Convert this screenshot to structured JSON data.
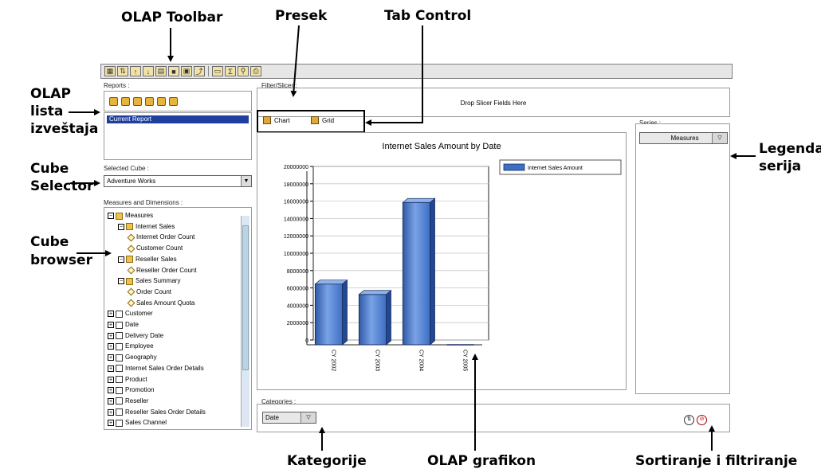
{
  "callouts": {
    "olap_toolbar": "OLAP Toolbar",
    "presek": "Presek",
    "tab_control": "Tab Control",
    "olap_lista_1": "OLAP",
    "olap_lista_2": "lista",
    "olap_lista_3": "izveštaja",
    "cube_selector_1": "Cube",
    "cube_selector_2": "Selector",
    "cube_browser_1": "Cube",
    "cube_browser_2": "browser",
    "legenda_1": "Legenda",
    "legenda_2": "serija",
    "kategorije": "Kategorije",
    "olap_grafikon": "OLAP grafikon",
    "sortiranje": "Sortiranje i filtriranje"
  },
  "reports": {
    "label": "Reports :",
    "items": [
      "Current Report"
    ]
  },
  "cube": {
    "label": "Selected Cube :",
    "value": "Adventure Works"
  },
  "tree": {
    "label": "Measures and Dimensions :",
    "rows": [
      {
        "text": "Measures",
        "level": 0,
        "box": "−",
        "icon": "folder"
      },
      {
        "text": "Internet Sales",
        "level": 1,
        "box": "−",
        "icon": "folder"
      },
      {
        "text": "Internet Order Count",
        "level": 2,
        "box": "",
        "icon": "measure"
      },
      {
        "text": "Customer Count",
        "level": 2,
        "box": "",
        "icon": "measure"
      },
      {
        "text": "Reseller Sales",
        "level": 1,
        "box": "−",
        "icon": "folder"
      },
      {
        "text": "Reseller Order Count",
        "level": 2,
        "box": "",
        "icon": "measure"
      },
      {
        "text": "Sales Summary",
        "level": 1,
        "box": "−",
        "icon": "folder"
      },
      {
        "text": "Order Count",
        "level": 2,
        "box": "",
        "icon": "measure"
      },
      {
        "text": "Sales Amount Quota",
        "level": 2,
        "box": "",
        "icon": "measure"
      },
      {
        "text": "Customer",
        "level": 0,
        "box": "+",
        "icon": "dim"
      },
      {
        "text": "Date",
        "level": 0,
        "box": "+",
        "icon": "dim"
      },
      {
        "text": "Delivery Date",
        "level": 0,
        "box": "+",
        "icon": "dim"
      },
      {
        "text": "Employee",
        "level": 0,
        "box": "+",
        "icon": "dim"
      },
      {
        "text": "Geography",
        "level": 0,
        "box": "+",
        "icon": "dim"
      },
      {
        "text": "Internet Sales Order Details",
        "level": 0,
        "box": "+",
        "icon": "dim"
      },
      {
        "text": "Product",
        "level": 0,
        "box": "+",
        "icon": "dim"
      },
      {
        "text": "Promotion",
        "level": 0,
        "box": "+",
        "icon": "dim"
      },
      {
        "text": "Reseller",
        "level": 0,
        "box": "+",
        "icon": "dim"
      },
      {
        "text": "Reseller Sales Order Details",
        "level": 0,
        "box": "+",
        "icon": "dim"
      },
      {
        "text": "Sales Channel",
        "level": 0,
        "box": "+",
        "icon": "dim"
      }
    ]
  },
  "filter": {
    "label": "Filter/Slicer :",
    "drop_text": "Drop Slicer Fields Here"
  },
  "tabs": {
    "chart": "Chart",
    "grid": "Grid"
  },
  "series_panel": {
    "label": "Series :",
    "value": "Measures"
  },
  "categories_panel": {
    "label": "Categories :",
    "value": "Date"
  },
  "chart_data": {
    "type": "bar",
    "title": "Internet Sales Amount by Date",
    "categories": [
      "CY 2002",
      "CY 2003",
      "CY 2004",
      "CY 2005"
    ],
    "series": [
      {
        "name": "Internet Sales Amount",
        "values": [
          7000000,
          5800000,
          16400000,
          0
        ]
      }
    ],
    "ylim": [
      0,
      20000000
    ],
    "yticks": [
      "20000000",
      "18000000",
      "16000000",
      "14000000",
      "12000000",
      "10000000",
      "8000000",
      "6000000",
      "4000000",
      "2000000",
      "0"
    ],
    "legend_position": "top-right",
    "bar_color": "#3d6fc4"
  }
}
